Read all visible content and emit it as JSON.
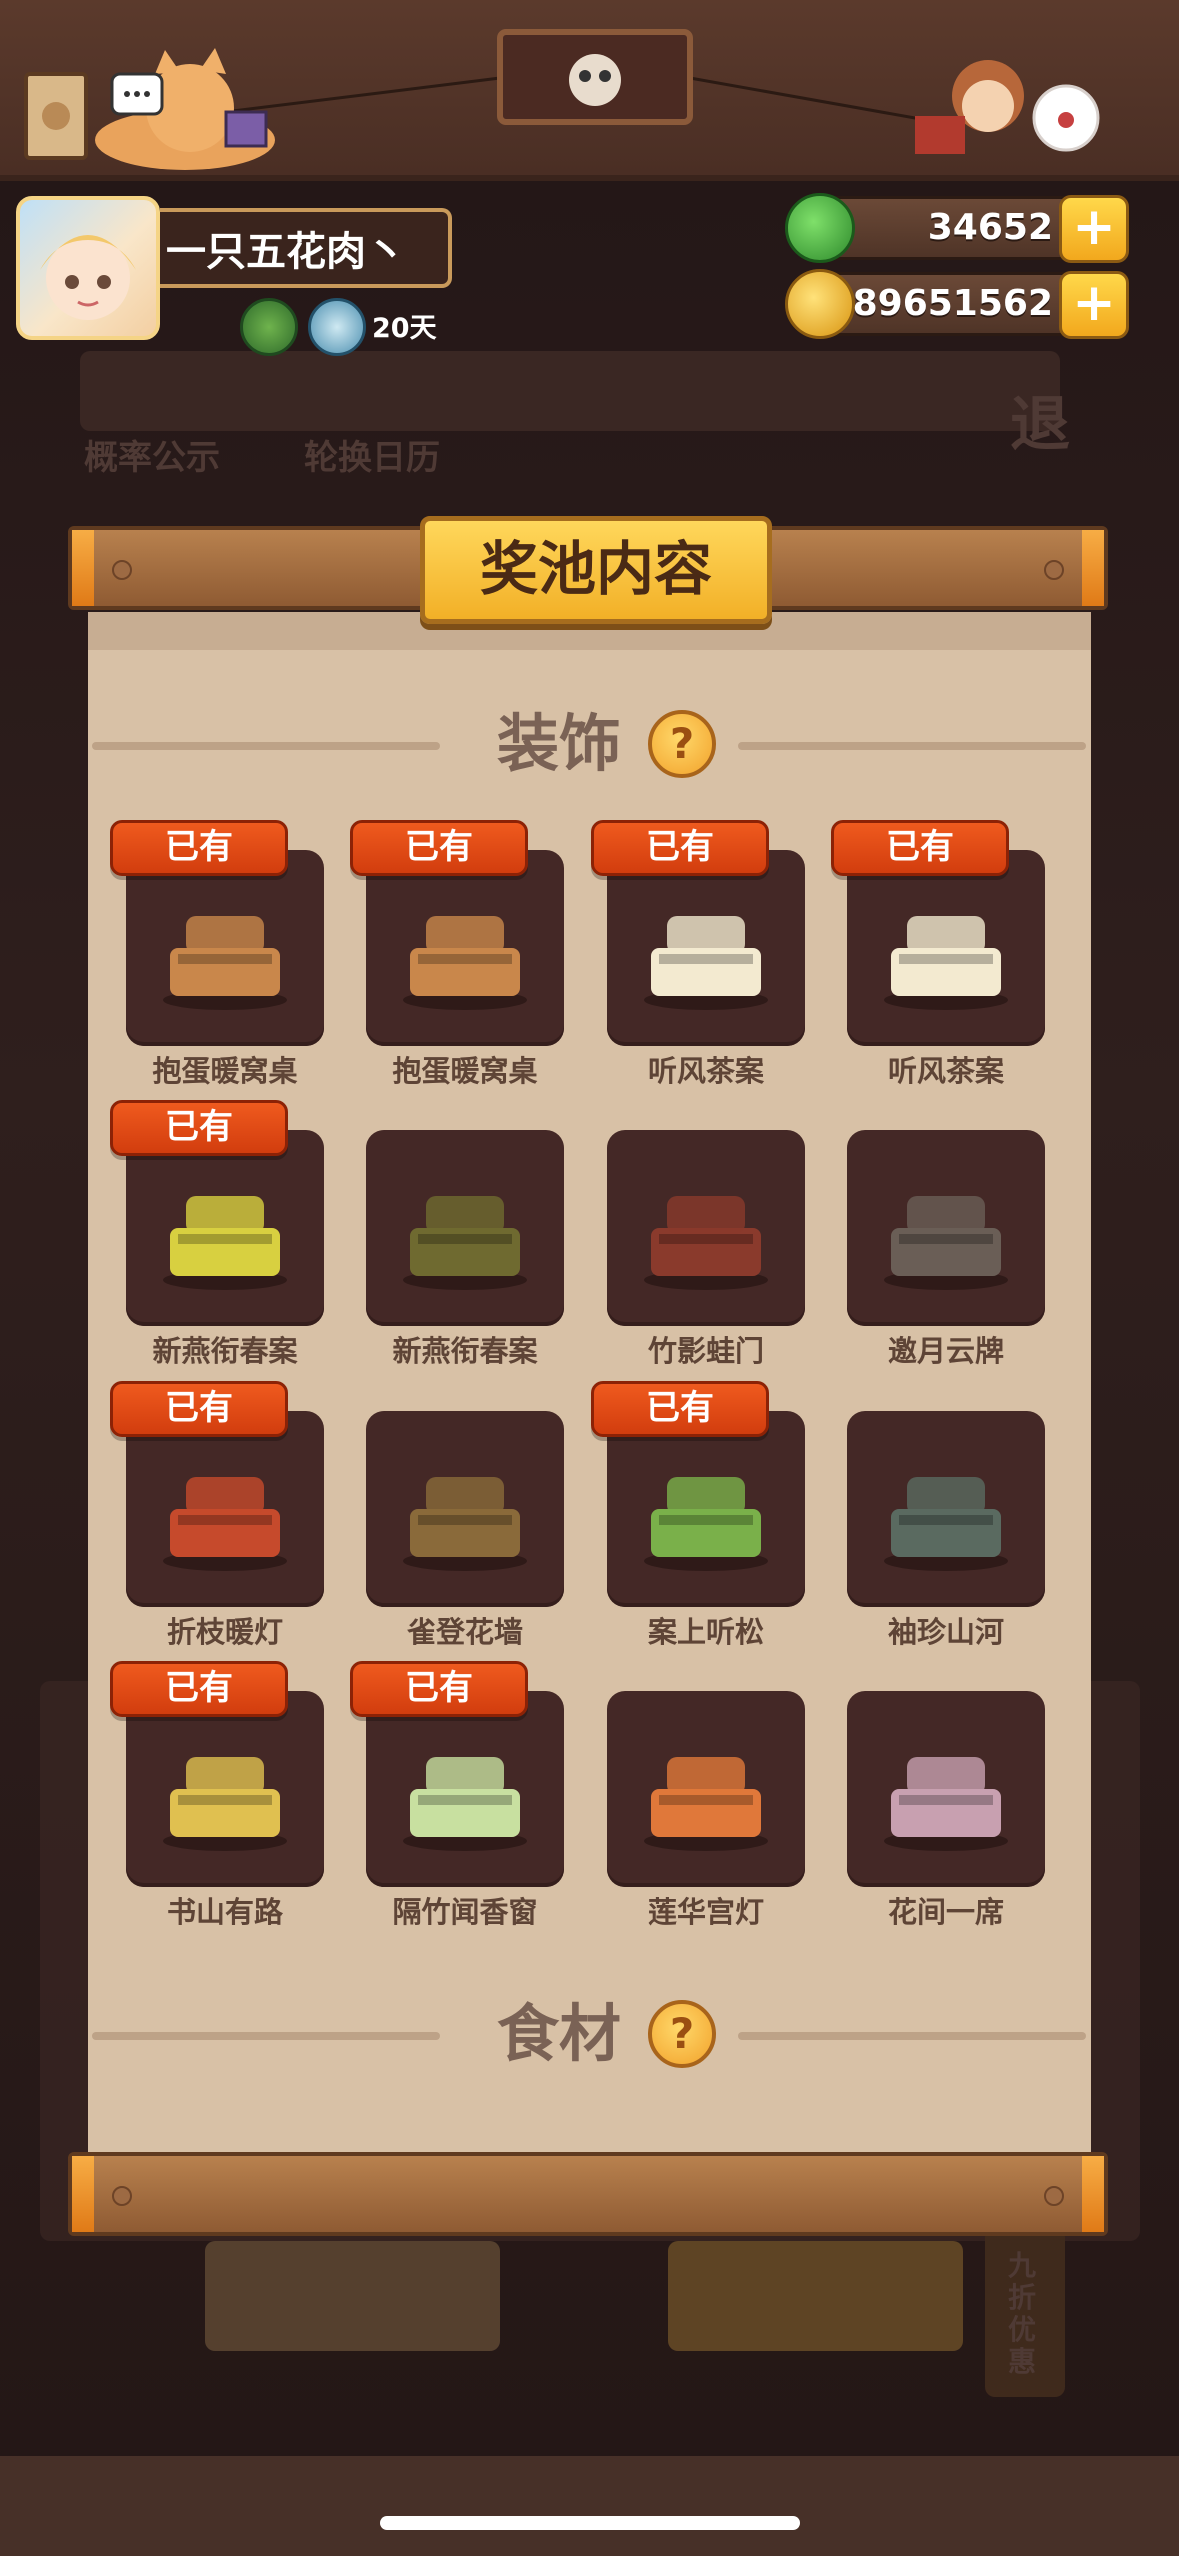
{
  "player": {
    "name": "一只五花肉丶",
    "days": "20天"
  },
  "currencies": [
    {
      "name": "jade",
      "value": "34652",
      "color": "#3fa53a"
    },
    {
      "name": "coin",
      "value": "89651562",
      "color": "#f2b525"
    }
  ],
  "background": {
    "probability": "概率公示",
    "calendar": "轮换日历",
    "exit": "退",
    "discount": "九折优惠"
  },
  "modal": {
    "title": "奖池内容",
    "sections": {
      "decor": "装饰",
      "ingredients": "食材"
    },
    "owned_label": "已有",
    "items": [
      {
        "name": "抱蛋暖窝桌",
        "owned": true,
        "icon": "table-hen-icon"
      },
      {
        "name": "抱蛋暖窝桌",
        "owned": true,
        "icon": "table-hen-icon"
      },
      {
        "name": "听风茶案",
        "owned": true,
        "icon": "tea-table-icon"
      },
      {
        "name": "听风茶案",
        "owned": true,
        "icon": "tea-table-icon"
      },
      {
        "name": "新燕衔春案",
        "owned": true,
        "icon": "spring-table-icon"
      },
      {
        "name": "新燕衔春案",
        "owned": false,
        "icon": "spring-table-dark-icon"
      },
      {
        "name": "竹影蛙门",
        "owned": false,
        "icon": "gate-icon"
      },
      {
        "name": "邀月云牌",
        "owned": false,
        "icon": "moon-sign-icon"
      },
      {
        "name": "折枝暖灯",
        "owned": true,
        "icon": "lamp-icon"
      },
      {
        "name": "雀登花墙",
        "owned": false,
        "icon": "flower-wall-icon"
      },
      {
        "name": "案上听松",
        "owned": true,
        "icon": "bonsai-icon"
      },
      {
        "name": "袖珍山河",
        "owned": false,
        "icon": "mini-landscape-icon"
      },
      {
        "name": "书山有路",
        "owned": true,
        "icon": "bookshelf-icon"
      },
      {
        "name": "隔竹闻香窗",
        "owned": true,
        "icon": "bamboo-window-icon"
      },
      {
        "name": "莲华宫灯",
        "owned": false,
        "icon": "palace-lantern-icon"
      },
      {
        "name": "花间一席",
        "owned": false,
        "icon": "flower-mat-icon"
      }
    ]
  },
  "colors": {
    "panel": "#d8c1a6",
    "card": "#442826",
    "owned_badge": "#e24a14",
    "title_plate": "#f5c23a"
  }
}
